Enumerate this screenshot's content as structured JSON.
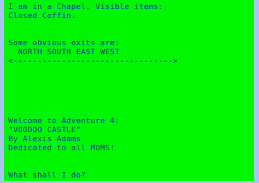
{
  "room": {
    "description": "I am in a Chapel. Visible items:",
    "items": "Closed Coffin."
  },
  "exits": {
    "header": "Some obvious exits are:",
    "list": "  NORTH SOUTH EAST WEST",
    "divider": "<--------------------------------->"
  },
  "welcome": {
    "line1": "Welcome to Adventure 4:",
    "title": "\"VOODOO CASTLE\"",
    "author": "By Alexis Adams",
    "dedication": "Dedicated to all MOMS!"
  },
  "prompt": {
    "text": "What shall I do?"
  },
  "colors": {
    "screen_background": "#00f600",
    "text": "#0a2fbf",
    "border": "#a7c5f0"
  }
}
